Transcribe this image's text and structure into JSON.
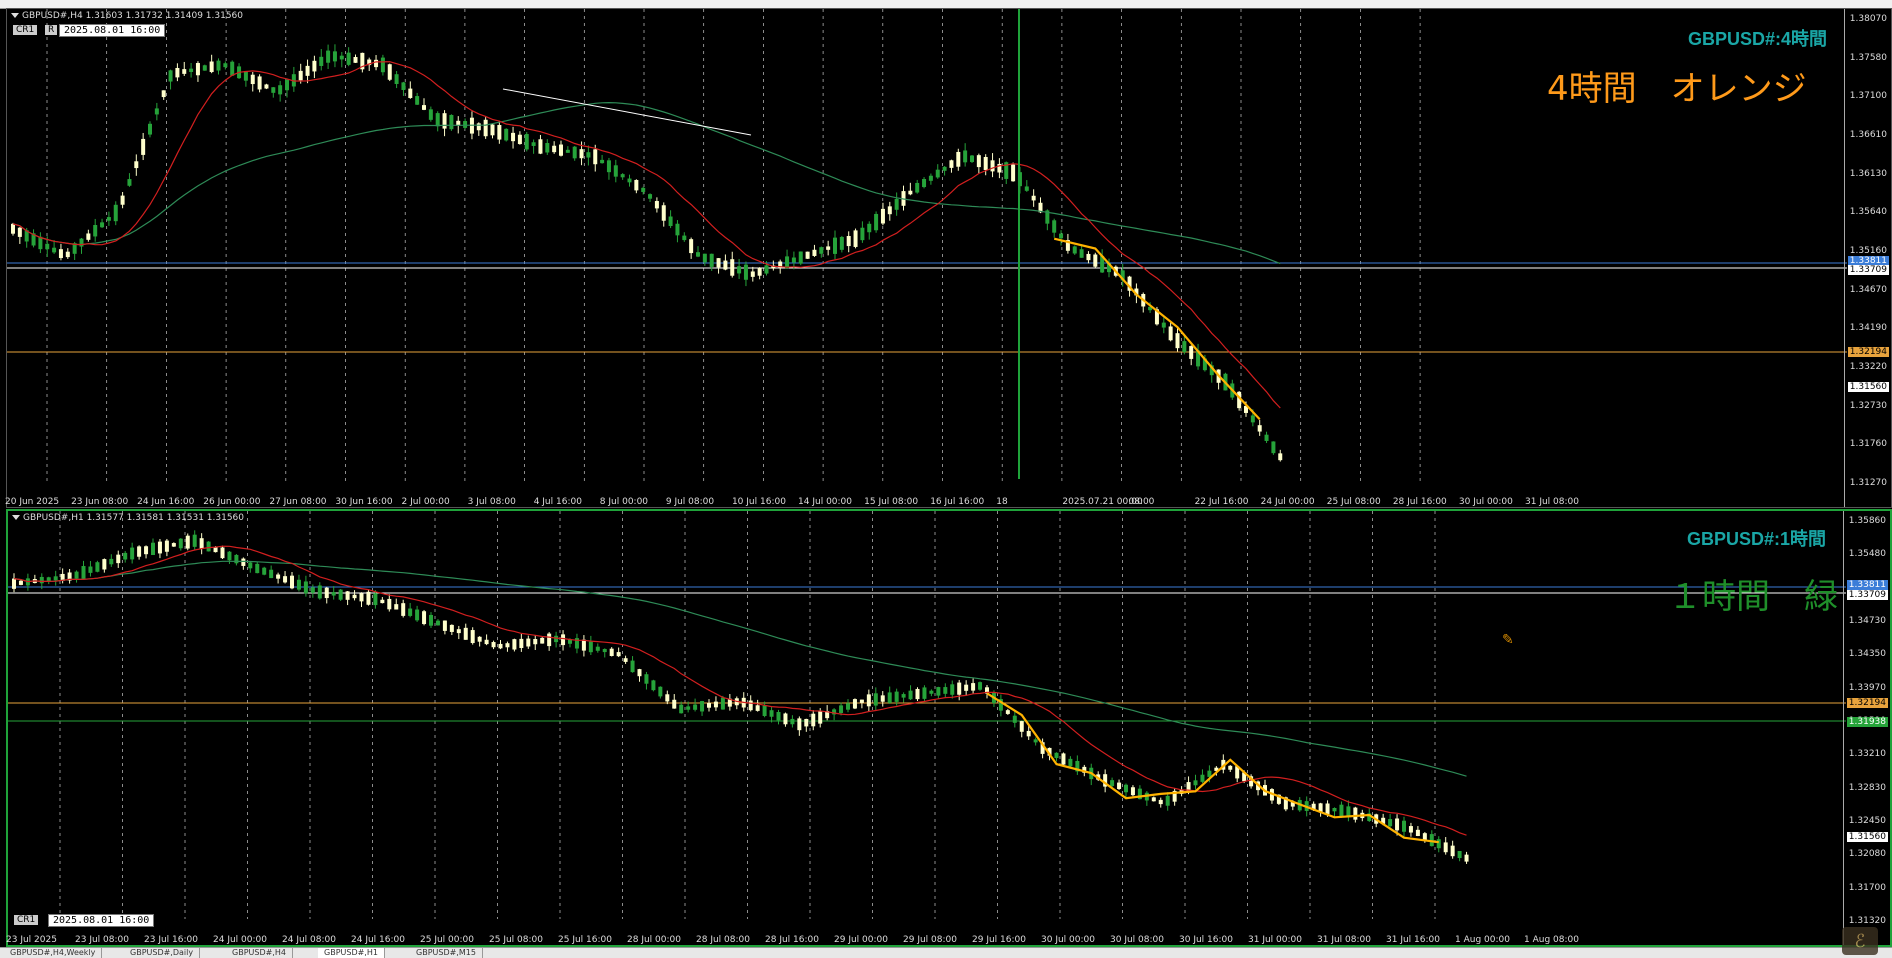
{
  "colors": {
    "bg": "#000000",
    "bull": "#ffffcc",
    "bear": "#26a33a",
    "ma_fast": "#d21f1f",
    "ma_slow": "#2e8b57",
    "zigzag": "#ffb300",
    "line_blue": "#3b7dd8",
    "line_white": "#ffffff",
    "line_orange": "#e8a33d",
    "line_green": "#26a33a",
    "title_teal": "#1aa6a6",
    "label_orange": "#ff9a1a",
    "label_green": "#1f8f2a",
    "grid": "#c8c8c8"
  },
  "top_chart": {
    "header": "GBPUSD#,H4  1.31603 1.31732 1.31409 1.31560",
    "cr_label": "CR1",
    "r_label": "R",
    "date_box": "2025.08.01 16:00",
    "symbol_title": "GBPUSD#:4時間",
    "jp_label": "4時間　オレンジ",
    "price_ticks": [
      "1.38070",
      "1.37580",
      "1.37100",
      "1.36610",
      "1.36130",
      "1.35640",
      "1.35160",
      "1.34670",
      "1.34190",
      "1.33220",
      "1.32730",
      "1.31760",
      "1.31270"
    ],
    "price_tags": [
      {
        "text": "1.33811",
        "color": "#3b7dd8"
      },
      {
        "text": "1.33709",
        "color": "#ffffff"
      },
      {
        "text": "1.32194",
        "color": "#e8a33d"
      },
      {
        "text": "1.31560",
        "color": "#ffffff"
      }
    ],
    "time_labels": [
      "20 Jun 2025",
      "23 Jun 08:00",
      "24 Jun 16:00",
      "26 Jun 00:00",
      "27 Jun 08:00",
      "30 Jun 16:00",
      "2 Jul 00:00",
      "3 Jul 08:00",
      "4 Jul 16:00",
      "8 Jul 00:00",
      "9 Jul 08:00",
      "10 Jul 16:00",
      "14 Jul 00:00",
      "15 Jul 08:00",
      "16 Jul 16:00",
      "18",
      "2025.07.21 00:00",
      "08:00",
      "22 Jul 16:00",
      "24 Jul 00:00",
      "25 Jul 08:00",
      "28 Jul 16:00",
      "30 Jul 00:00",
      "31 Jul 08:00"
    ]
  },
  "bottom_chart": {
    "header": "GBPUSD#,H1  1.31577 1.31581 1.31531 1.31560",
    "cr_label": "CR1",
    "date_box": "2025.08.01 16:00",
    "symbol_title": "GBPUSD#:1時間",
    "jp_label": "１時間　緑",
    "price_ticks": [
      "1.35860",
      "1.35480",
      "1.35110",
      "1.34730",
      "1.34350",
      "1.33970",
      "1.33590",
      "1.33210",
      "1.32830",
      "1.32450",
      "1.32080",
      "1.31700",
      "1.31320"
    ],
    "price_tags": [
      {
        "text": "1.33811",
        "color": "#3b7dd8"
      },
      {
        "text": "1.33709",
        "color": "#ffffff"
      },
      {
        "text": "1.32194",
        "color": "#e8a33d"
      },
      {
        "text": "1.31938",
        "color": "#26a33a"
      },
      {
        "text": "1.31560",
        "color": "#ffffff"
      }
    ],
    "time_labels": [
      "23 Jul 2025",
      "23 Jul 08:00",
      "23 Jul 16:00",
      "24 Jul 00:00",
      "24 Jul 08:00",
      "24 Jul 16:00",
      "25 Jul 00:00",
      "25 Jul 08:00",
      "25 Jul 16:00",
      "28 Jul 00:00",
      "28 Jul 08:00",
      "28 Jul 16:00",
      "29 Jul 00:00",
      "29 Jul 08:00",
      "29 Jul 16:00",
      "30 Jul 00:00",
      "30 Jul 08:00",
      "30 Jul 16:00",
      "31 Jul 00:00",
      "31 Jul 08:00",
      "31 Jul 16:00",
      "1 Aug 00:00",
      "1 Aug 08:00"
    ]
  },
  "tabs": [
    "GBPUSD#,H4,Weekly",
    "GBPUSD#,Daily",
    "GBPUSD#,H4",
    "GBPUSD#,H1",
    "GBPUSD#,M15"
  ]
}
